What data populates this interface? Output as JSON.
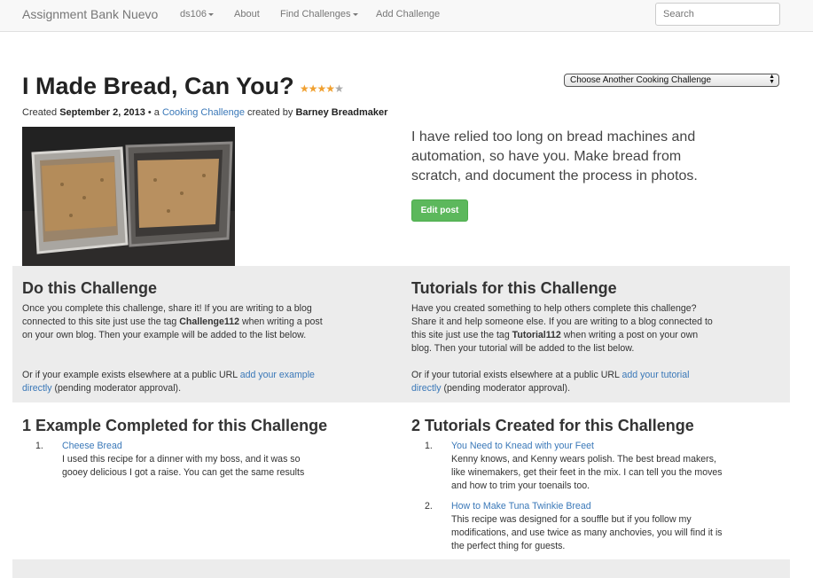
{
  "nav": {
    "brand": "Assignment Bank Nuevo",
    "items": [
      {
        "label": "ds106",
        "dropdown": true
      },
      {
        "label": "About",
        "dropdown": false
      },
      {
        "label": "Find Challenges",
        "dropdown": true
      },
      {
        "label": "Add Challenge",
        "dropdown": false
      }
    ],
    "search_placeholder": "Search"
  },
  "header": {
    "title": "I Made Bread, Can You?",
    "rating": {
      "value": 4,
      "max": 5
    },
    "select_value": "Choose Another Cooking Challenge",
    "meta": {
      "created_prefix": "Created",
      "date": "September 2, 2013",
      "bullet_a": "• a",
      "category_link": "Cooking Challenge",
      "created_by": "created by",
      "author": "Barney Breadmaker"
    }
  },
  "lead": "I have relied too long on bread machines and automation, so have you. Make bread from scratch, and document the process in photos.",
  "edit_button": "Edit post",
  "do_section": {
    "heading": "Do this Challenge",
    "text_a": "Once you complete this challenge, share it! If you are writing to a blog connected to this site just use the tag",
    "tag": "Challenge112",
    "text_b": "when writing a post on your own blog. Then your example will be added to the list below.",
    "url_prefix": "Or if your example exists elsewhere at a public URL",
    "url_link": "add your example directly",
    "url_suffix": "(pending moderator approval)."
  },
  "tutorial_section": {
    "heading": "Tutorials for this Challenge",
    "text_a": "Have you created something to help others complete this challenge? Share it and help someone else. If you are writing to a blog connected to this site just use the tag",
    "tag": "Tutorial112",
    "text_b": "when writing a post on your own blog. Then your tutorial will be added to the list below.",
    "url_prefix": "Or if your tutorial exists elsewhere at a public URL",
    "url_link": "add your tutorial directly",
    "url_suffix": "(pending moderator approval)."
  },
  "examples": {
    "heading": "1 Example Completed for this Challenge",
    "items": [
      {
        "num": "1.",
        "title": "Cheese Bread",
        "desc": "I used this recipe for a dinner with my boss, and it was so gooey delicious I got a raise. You can get the same results"
      }
    ]
  },
  "tutorials": {
    "heading": "2 Tutorials Created for this Challenge",
    "items": [
      {
        "num": "1.",
        "title": "You Need to Knead with your Feet",
        "desc": "Kenny knows, and Kenny wears polish. The best bread makers, like winemakers, get their feet in the mix. I can tell you the moves and how to trim your toenails too."
      },
      {
        "num": "2.",
        "title": "How to Make Tuna Twinkie Bread",
        "desc": "This recipe was designed for a souffle but if you follow my modifications, and use twice as many anchovies, you will find it is the perfect thing for guests."
      }
    ]
  },
  "colors": {
    "link": "#3a78b8",
    "button": "#5cb85c",
    "well": "#ececec",
    "star": "#f0a030"
  }
}
